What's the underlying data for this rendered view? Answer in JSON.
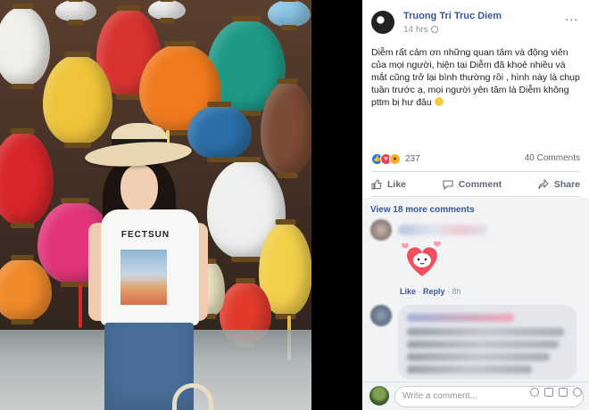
{
  "post": {
    "author": "Truong Tri Truc Diem",
    "time": "14 hrs",
    "more_label": "...",
    "text": "Diễm rất cảm ơn những quan tâm và động viên của mọi người, hiện tại Diễm đã khoẻ nhiều và mắt cũng trở lại bình thường rồi , hình này là chụp tuần trước ạ, mọi người yên tâm là Diễm không pttm bị hư đâu",
    "shirt_print": "FECTSUN"
  },
  "stats": {
    "reaction_count": "237",
    "comment_count": "40 Comments"
  },
  "actions": {
    "like": "Like",
    "comment": "Comment",
    "share": "Share"
  },
  "comments": {
    "view_more": "View 18 more comments",
    "first": {
      "like_label": "Like",
      "separator": " · ",
      "reply_label": "Reply",
      "time": " · 8h"
    }
  },
  "composer": {
    "placeholder": "Write a comment..."
  },
  "colors": {
    "link": "#385898",
    "like_blue": "#1877f2",
    "love_red": "#f33e58"
  },
  "icons": [
    "like-icon",
    "comment-icon",
    "share-icon",
    "globe-icon",
    "emoji-icon",
    "camera-icon",
    "gif-icon",
    "sticker-icon"
  ]
}
